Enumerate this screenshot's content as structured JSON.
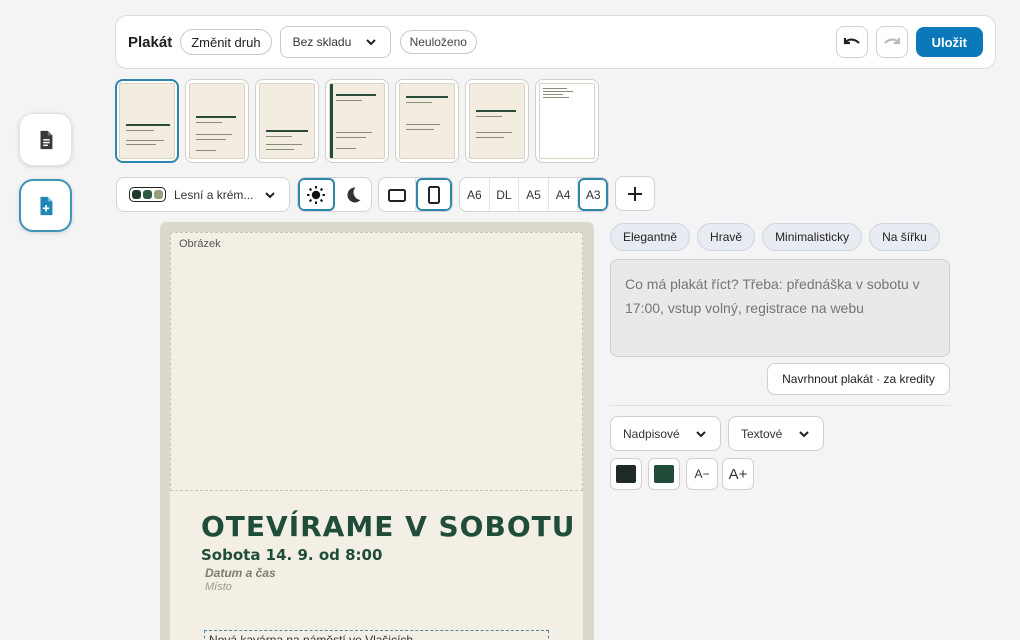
{
  "toolbar": {
    "title": "Plakát",
    "change_type_label": "Změnit druh",
    "template_select": "Bez skladu",
    "save_status": "Neuloženo",
    "save_label": "Uložit"
  },
  "options": {
    "theme_select": "Lesní a krém...",
    "brightness_modes": [
      "light-mode-icon",
      "dark-mode-icon"
    ],
    "orientations": [
      "landscape-icon",
      "portrait-icon"
    ],
    "sizes": [
      "A6",
      "DL",
      "A5",
      "A4",
      "A3"
    ],
    "selected_size": "A3",
    "theme_colors": [
      "#1f3a2b",
      "#2f5a45",
      "#8fa07a"
    ]
  },
  "poster": {
    "image_label": "Obrázek",
    "title": "OTEVÍRAME V SOBOTU",
    "date": "Sobota 14. 9. od 8:00",
    "datetime_placeholder": "Datum a čas",
    "place_placeholder": "Místo",
    "body": "Nová kavárna na náměstí ve Vlašicích"
  },
  "panel": {
    "styles": [
      "Elegantně",
      "Hravě",
      "Minimalisticky",
      "Na šířku"
    ],
    "prompt_placeholder": "Co má plakát říct? Třeba: přednáška v sobotu v 17:00, vstup volný, registrace na webu",
    "suggest_label": "Navrhnout plakát · za kredity",
    "heading_font": "Nadpisové",
    "text_font": "Textové",
    "text_colors": [
      "#1f2a24",
      "#1f4d3a"
    ],
    "size_down": "A−",
    "size_up": "A+"
  }
}
